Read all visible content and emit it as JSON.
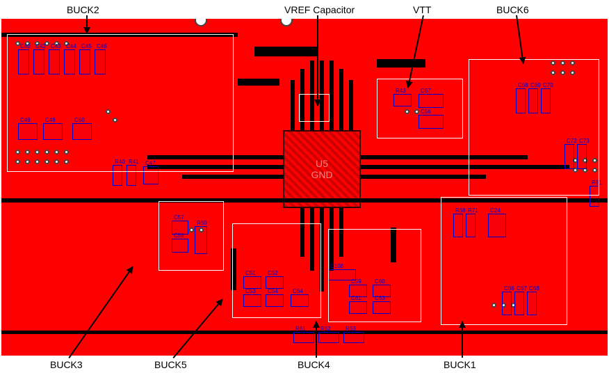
{
  "labels": {
    "buck1": "BUCK1",
    "buck2": "BUCK2",
    "buck3": "BUCK3",
    "buck4": "BUCK4",
    "buck5": "BUCK5",
    "buck6": "BUCK6",
    "vtt": "VTT",
    "vref": "VREF Capacitor"
  },
  "ic": {
    "designator": "U5",
    "net_label": "GND"
  },
  "components": {
    "left_bank_refs": [
      "C40",
      "C42",
      "C43",
      "C44",
      "C45",
      "C46",
      "C48",
      "C49",
      "C50",
      "R40",
      "R41"
    ],
    "mid_refs": [
      "C47",
      "C51",
      "C52",
      "C53",
      "C54",
      "C56",
      "C57",
      "C58",
      "C59",
      "C60",
      "C61",
      "C63",
      "C64",
      "C66",
      "C67",
      "C68",
      "C69",
      "C70",
      "C108",
      "R43",
      "R60",
      "R61",
      "R62",
      "R63",
      "R68",
      "R71",
      "C72",
      "C73",
      "C24",
      "R81"
    ],
    "note": "visible passive reference designators around the PMIC; positions approximated"
  }
}
